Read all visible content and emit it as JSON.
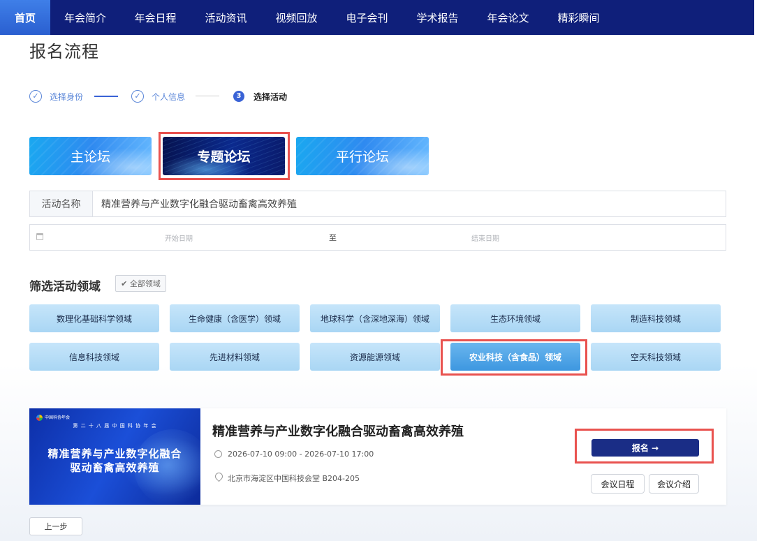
{
  "nav": {
    "items": [
      "首页",
      "年会简介",
      "年会日程",
      "活动资讯",
      "视频回放",
      "电子会刊",
      "学术报告",
      "年会论文",
      "精彩瞬间"
    ],
    "active_index": 0
  },
  "page": {
    "title": "报名流程"
  },
  "steps": {
    "items": [
      {
        "label": "选择身份",
        "state": "done"
      },
      {
        "label": "个人信息",
        "state": "done"
      },
      {
        "number": "3",
        "label": "选择活动",
        "state": "current"
      }
    ]
  },
  "forums": {
    "tabs": [
      "主论坛",
      "专题论坛",
      "平行论坛"
    ],
    "active_index": 1
  },
  "search": {
    "name_label": "活动名称",
    "name_value": "精准营养与产业数字化融合驱动畜禽高效养殖",
    "start_placeholder": "开始日期",
    "separator": "至",
    "end_placeholder": "结束日期"
  },
  "filter": {
    "title": "筛选活动领域",
    "all_label": "✔ 全部领域",
    "domains": [
      "数理化基础科学领域",
      "生命健康（含医学）领域",
      "地球科学（含深地深海）领域",
      "生态环境领域",
      "制造科技领域",
      "信息科技领域",
      "先进材料领域",
      "资源能源领域",
      "农业科技（含食品）领域",
      "空天科技领域"
    ],
    "active_index": 8
  },
  "event": {
    "poster": {
      "org": "中国科协年会",
      "subtitle": "第 二 十 八 届 中 国 科 协 年 会",
      "line1": "精准营养与产业数字化融合",
      "line2": "驱动畜禽高效养殖"
    },
    "title": "精准营养与产业数字化融合驱动畜禽高效养殖",
    "time": "2026-07-10 09:00 - 2026-07-10 17:00",
    "location": "北京市海淀区中国科技会堂 B204-205",
    "signup_label": "报名 →",
    "schedule_label": "会议日程",
    "intro_label": "会议介绍"
  },
  "footer": {
    "prev_label": "上一步"
  },
  "colors": {
    "nav_bg": "#0f1f7a",
    "nav_active": "#2a5fd0",
    "highlight_red": "#e9524f",
    "primary_dark": "#1a2d86",
    "domain_bg": "#b6dcf6",
    "domain_active": "#3d97e0"
  }
}
